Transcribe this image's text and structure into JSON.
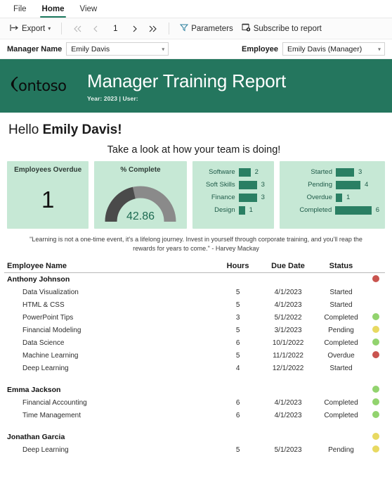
{
  "ribbon": {
    "tabs": [
      {
        "label": "File",
        "active": false
      },
      {
        "label": "Home",
        "active": true
      },
      {
        "label": "View",
        "active": false
      }
    ]
  },
  "toolbar": {
    "export_label": "Export",
    "export_icon": "export-icon",
    "first_page_icon": "first-page-icon",
    "prev_page_icon": "previous-page-icon",
    "page_number": "1",
    "next_page_icon": "next-page-icon",
    "last_page_icon": "last-page-icon",
    "parameters_label": "Parameters",
    "parameters_icon": "filter-icon",
    "subscribe_label": "Subscribe to report",
    "subscribe_icon": "subscribe-icon"
  },
  "parameters": {
    "manager_label": "Manager Name",
    "manager_value": "Emily Davis",
    "employee_label": "Employee",
    "employee_value": "Emily Davis (Manager)"
  },
  "banner": {
    "logo_text": "ontoso",
    "title": "Manager Training Report",
    "subtitle": "Year: 2023 | User:",
    "bg_color": "#24765e"
  },
  "greeting": {
    "hello_prefix": "Hello ",
    "name": "Emily Davis!",
    "subtitle": "Take a look at how your team is doing!"
  },
  "kpis": {
    "overdue": {
      "title": "Employees Overdue",
      "value": "1"
    },
    "percent_complete": {
      "title": "% Complete",
      "value": "42.86",
      "max": 100,
      "arc_color": "#4a4a4a",
      "track_color": "#8a8a8a"
    }
  },
  "chart_data": [
    {
      "type": "bar",
      "title": "",
      "orientation": "horizontal",
      "categories": [
        "Software",
        "Soft Skills",
        "Finance",
        "Design"
      ],
      "values": [
        2,
        3,
        3,
        1
      ],
      "xlabel": "",
      "ylabel": "",
      "xlim": [
        0,
        3
      ],
      "grid": false,
      "legend": "none",
      "bar_color": "#2a7f63"
    },
    {
      "type": "bar",
      "title": "",
      "orientation": "horizontal",
      "categories": [
        "Started",
        "Pending",
        "Overdue",
        "Completed"
      ],
      "values": [
        3,
        4,
        1,
        6
      ],
      "xlabel": "",
      "ylabel": "",
      "xlim": [
        0,
        6
      ],
      "grid": false,
      "legend": "none",
      "bar_color": "#2a7f63"
    },
    {
      "type": "gauge",
      "title": "% Complete",
      "value": 42.86,
      "min": 0,
      "max": 100,
      "filled_color": "#4a4a4a",
      "track_color": "#8a8a8a"
    }
  ],
  "quote": "\"Learning is not a one-time event, it's a lifelong journey. Invest in yourself through corporate training, and you'll reap the rewards for years to come.\" - Harvey Mackay",
  "table": {
    "columns": [
      "Employee Name",
      "Hours",
      "Due Date",
      "Status",
      ""
    ],
    "status_colors": {
      "Completed": "#92d36e",
      "Pending": "#e8d961",
      "Overdue": "#c9544f",
      "Started": ""
    },
    "rows": [
      {
        "type": "group",
        "name": "Anthony Johnson",
        "hours": "",
        "due": "",
        "status": "",
        "dot": "#c9544f"
      },
      {
        "type": "child",
        "name": "Data Visualization",
        "hours": "5",
        "due": "4/1/2023",
        "status": "Started",
        "dot": ""
      },
      {
        "type": "child",
        "name": "HTML & CSS",
        "hours": "5",
        "due": "4/1/2023",
        "status": "Started",
        "dot": ""
      },
      {
        "type": "child",
        "name": "PowerPoint Tips",
        "hours": "3",
        "due": "5/1/2022",
        "status": "Completed",
        "dot": "#92d36e"
      },
      {
        "type": "child",
        "name": "Financial Modeling",
        "hours": "5",
        "due": "3/1/2023",
        "status": "Pending",
        "dot": "#e8d961"
      },
      {
        "type": "child",
        "name": "Data Science",
        "hours": "6",
        "due": "10/1/2022",
        "status": "Completed",
        "dot": "#92d36e"
      },
      {
        "type": "child",
        "name": "Machine Learning",
        "hours": "5",
        "due": "11/1/2022",
        "status": "Overdue",
        "dot": "#c9544f"
      },
      {
        "type": "child",
        "name": "Deep Learning",
        "hours": "4",
        "due": "12/1/2022",
        "status": "Started",
        "dot": ""
      },
      {
        "type": "spacer",
        "name": "",
        "hours": "",
        "due": "",
        "status": "",
        "dot": ""
      },
      {
        "type": "group",
        "name": "Emma Jackson",
        "hours": "",
        "due": "",
        "status": "",
        "dot": "#92d36e"
      },
      {
        "type": "child",
        "name": "Financial Accounting",
        "hours": "6",
        "due": "4/1/2023",
        "status": "Completed",
        "dot": "#92d36e"
      },
      {
        "type": "child",
        "name": "Time Management",
        "hours": "6",
        "due": "4/1/2023",
        "status": "Completed",
        "dot": "#92d36e"
      },
      {
        "type": "spacer",
        "name": "",
        "hours": "",
        "due": "",
        "status": "",
        "dot": ""
      },
      {
        "type": "group",
        "name": "Jonathan Garcia",
        "hours": "",
        "due": "",
        "status": "",
        "dot": "#e8d961"
      },
      {
        "type": "child",
        "name": "Deep Learning",
        "hours": "5",
        "due": "5/1/2023",
        "status": "Pending",
        "dot": "#e8d961"
      }
    ]
  }
}
